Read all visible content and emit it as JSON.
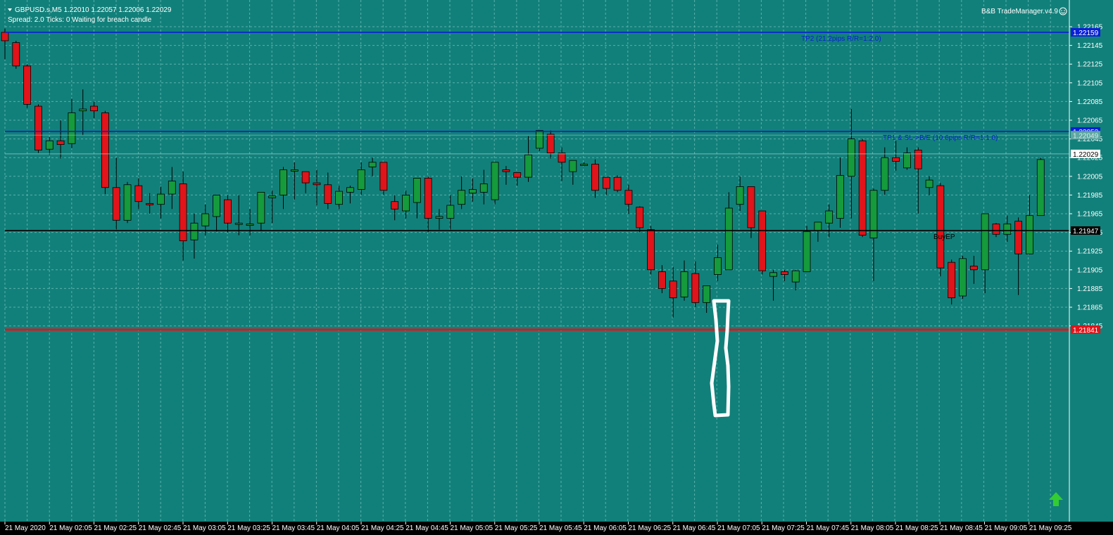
{
  "header": {
    "symbol_line": "GBPUSD.s,M5  1.22010 1.22057 1.22006 1.22029",
    "status_line": "Spread: 2.0  Ticks: 0  Waiting for breach candle",
    "ea_name": "B&B TradeManager.v4.9"
  },
  "colors": {
    "background": "#12807a",
    "grid": "#5bb0a9",
    "bull": "#159a3c",
    "bear": "#e0141a",
    "tp_line": "#0a1fd8",
    "entry_line": "#000000",
    "sl_line": "#e0141a",
    "annotation": "#ffffff",
    "arrow": "#33cc33"
  },
  "lines": {
    "tp2": {
      "price": 1.22159,
      "label": "TP2 (21.2pips R/R=1:2.0)",
      "tag": "1.22159"
    },
    "tp1": {
      "price": 1.22053,
      "label": "TP1 & SL->B/E (10.6pips R/R=1:1.0)",
      "tag": "1.22053"
    },
    "entry": {
      "price": 1.21947,
      "label": "BuyEP",
      "tag": "1.21947"
    },
    "sl": {
      "price": 1.21841,
      "tag": "1.21841"
    },
    "bid": {
      "price": 1.22029,
      "tag": "1.22029"
    },
    "ask": {
      "price": 1.22049,
      "tag": "1.22049"
    }
  },
  "price_axis": {
    "ticks": [
      "1.22165",
      "1.22145",
      "1.22125",
      "1.22105",
      "1.22085",
      "1.22065",
      "1.22045",
      "1.22025",
      "1.22005",
      "1.21985",
      "1.21965",
      "1.21945",
      "1.21925",
      "1.21905",
      "1.21885",
      "1.21865",
      "1.21845"
    ]
  },
  "time_axis": {
    "labels": [
      "21 May 2020",
      "21 May 02:05",
      "21 May 02:25",
      "21 May 02:45",
      "21 May 03:05",
      "21 May 03:25",
      "21 May 03:45",
      "21 May 04:05",
      "21 May 04:25",
      "21 May 04:45",
      "21 May 05:05",
      "21 May 05:25",
      "21 May 05:45",
      "21 May 06:05",
      "21 May 06:25",
      "21 May 06:45",
      "21 May 07:05",
      "21 May 07:25",
      "21 May 07:45",
      "21 May 08:05",
      "21 May 08:25",
      "21 May 08:45",
      "21 May 09:05",
      "21 May 09:25"
    ]
  },
  "icons": {
    "menu": "triangle-down-icon",
    "smiley": "smiley-icon",
    "arrow": "up-arrow-icon"
  },
  "chart_data": {
    "type": "candlestick",
    "symbol": "GBPUSD.s",
    "timeframe": "M5",
    "ylim": [
      1.21834,
      1.2218
    ],
    "candles": [
      {
        "o": 1.22159,
        "h": 1.22163,
        "l": 1.2213,
        "c": 1.2215
      },
      {
        "o": 1.22148,
        "h": 1.2215,
        "l": 1.2212,
        "c": 1.22123
      },
      {
        "o": 1.22123,
        "h": 1.22125,
        "l": 1.22078,
        "c": 1.22082
      },
      {
        "o": 1.2208,
        "h": 1.22082,
        "l": 1.2203,
        "c": 1.22033
      },
      {
        "o": 1.22034,
        "h": 1.22047,
        "l": 1.22028,
        "c": 1.22043
      },
      {
        "o": 1.22043,
        "h": 1.22065,
        "l": 1.22024,
        "c": 1.22039
      },
      {
        "o": 1.2204,
        "h": 1.22088,
        "l": 1.22035,
        "c": 1.22073
      },
      {
        "o": 1.22075,
        "h": 1.22098,
        "l": 1.22049,
        "c": 1.22077
      },
      {
        "o": 1.2208,
        "h": 1.22085,
        "l": 1.22067,
        "c": 1.22075
      },
      {
        "o": 1.22073,
        "h": 1.22075,
        "l": 1.21986,
        "c": 1.21993
      },
      {
        "o": 1.21993,
        "h": 1.22025,
        "l": 1.21948,
        "c": 1.21958
      },
      {
        "o": 1.21958,
        "h": 1.21999,
        "l": 1.21955,
        "c": 1.21996
      },
      {
        "o": 1.21995,
        "h": 1.22003,
        "l": 1.2197,
        "c": 1.21978
      },
      {
        "o": 1.21976,
        "h": 1.21987,
        "l": 1.21965,
        "c": 1.21975
      },
      {
        "o": 1.21975,
        "h": 1.21994,
        "l": 1.2196,
        "c": 1.21986
      },
      {
        "o": 1.21986,
        "h": 1.22015,
        "l": 1.2197,
        "c": 1.22
      },
      {
        "o": 1.21997,
        "h": 1.2201,
        "l": 1.21915,
        "c": 1.21936
      },
      {
        "o": 1.21937,
        "h": 1.21965,
        "l": 1.21917,
        "c": 1.21955
      },
      {
        "o": 1.21952,
        "h": 1.21975,
        "l": 1.21942,
        "c": 1.21965
      },
      {
        "o": 1.21962,
        "h": 1.2198,
        "l": 1.21946,
        "c": 1.21985
      },
      {
        "o": 1.2198,
        "h": 1.21985,
        "l": 1.21945,
        "c": 1.21955
      },
      {
        "o": 1.21954,
        "h": 1.21985,
        "l": 1.21942,
        "c": 1.21955
      },
      {
        "o": 1.21954,
        "h": 1.2197,
        "l": 1.21942,
        "c": 1.21954
      },
      {
        "o": 1.21955,
        "h": 1.2198,
        "l": 1.21947,
        "c": 1.21988
      },
      {
        "o": 1.21982,
        "h": 1.2199,
        "l": 1.21955,
        "c": 1.21984
      },
      {
        "o": 1.21985,
        "h": 1.22015,
        "l": 1.2197,
        "c": 1.22012
      },
      {
        "o": 1.22012,
        "h": 1.2202,
        "l": 1.2198,
        "c": 1.22012
      },
      {
        "o": 1.2201,
        "h": 1.22008,
        "l": 1.21987,
        "c": 1.21998
      },
      {
        "o": 1.21998,
        "h": 1.22012,
        "l": 1.21974,
        "c": 1.21996
      },
      {
        "o": 1.21996,
        "h": 1.22009,
        "l": 1.2197,
        "c": 1.21976
      },
      {
        "o": 1.21975,
        "h": 1.21995,
        "l": 1.2197,
        "c": 1.21989
      },
      {
        "o": 1.21988,
        "h": 1.21995,
        "l": 1.21976,
        "c": 1.21993
      },
      {
        "o": 1.21991,
        "h": 1.2202,
        "l": 1.21985,
        "c": 1.22012
      },
      {
        "o": 1.22015,
        "h": 1.22025,
        "l": 1.22005,
        "c": 1.2202
      },
      {
        "o": 1.2202,
        "h": 1.22018,
        "l": 1.21985,
        "c": 1.2199
      },
      {
        "o": 1.21978,
        "h": 1.21985,
        "l": 1.21958,
        "c": 1.2197
      },
      {
        "o": 1.21968,
        "h": 1.2199,
        "l": 1.2196,
        "c": 1.21985
      },
      {
        "o": 1.21977,
        "h": 1.22,
        "l": 1.2196,
        "c": 1.22003
      },
      {
        "o": 1.22003,
        "h": 1.22005,
        "l": 1.21945,
        "c": 1.2196
      },
      {
        "o": 1.2196,
        "h": 1.2197,
        "l": 1.21948,
        "c": 1.21962
      },
      {
        "o": 1.2196,
        "h": 1.21985,
        "l": 1.21948,
        "c": 1.21974
      },
      {
        "o": 1.21975,
        "h": 1.22005,
        "l": 1.2197,
        "c": 1.2199
      },
      {
        "o": 1.21987,
        "h": 1.22003,
        "l": 1.21978,
        "c": 1.21991
      },
      {
        "o": 1.21988,
        "h": 1.22012,
        "l": 1.21975,
        "c": 1.21997
      },
      {
        "o": 1.2198,
        "h": 1.2202,
        "l": 1.21975,
        "c": 1.2202
      },
      {
        "o": 1.22012,
        "h": 1.22016,
        "l": 1.21996,
        "c": 1.2201
      },
      {
        "o": 1.22009,
        "h": 1.22005,
        "l": 1.21995,
        "c": 1.22004
      },
      {
        "o": 1.22004,
        "h": 1.22048,
        "l": 1.21999,
        "c": 1.22028
      },
      {
        "o": 1.22035,
        "h": 1.22054,
        "l": 1.22032,
        "c": 1.22054
      },
      {
        "o": 1.2205,
        "h": 1.22054,
        "l": 1.22024,
        "c": 1.2203
      },
      {
        "o": 1.2203,
        "h": 1.22036,
        "l": 1.22,
        "c": 1.2202
      },
      {
        "o": 1.2201,
        "h": 1.2202,
        "l": 1.21996,
        "c": 1.22022
      },
      {
        "o": 1.22018,
        "h": 1.2202,
        "l": 1.22016,
        "c": 1.22018
      },
      {
        "o": 1.22018,
        "h": 1.22023,
        "l": 1.21982,
        "c": 1.2199
      },
      {
        "o": 1.22004,
        "h": 1.22003,
        "l": 1.21985,
        "c": 1.21992
      },
      {
        "o": 1.22004,
        "h": 1.22006,
        "l": 1.21988,
        "c": 1.2199
      },
      {
        "o": 1.2199,
        "h": 1.21996,
        "l": 1.21965,
        "c": 1.21975
      },
      {
        "o": 1.21972,
        "h": 1.21973,
        "l": 1.21945,
        "c": 1.2195
      },
      {
        "o": 1.21948,
        "h": 1.21952,
        "l": 1.219,
        "c": 1.21905
      },
      {
        "o": 1.21903,
        "h": 1.2191,
        "l": 1.2188,
        "c": 1.21885
      },
      {
        "o": 1.21893,
        "h": 1.21908,
        "l": 1.21854,
        "c": 1.21875
      },
      {
        "o": 1.21876,
        "h": 1.21915,
        "l": 1.21872,
        "c": 1.21903
      },
      {
        "o": 1.21901,
        "h": 1.21914,
        "l": 1.21865,
        "c": 1.2187
      },
      {
        "o": 1.2187,
        "h": 1.21888,
        "l": 1.21859,
        "c": 1.21888
      },
      {
        "o": 1.219,
        "h": 1.21932,
        "l": 1.21893,
        "c": 1.21918
      },
      {
        "o": 1.21905,
        "h": 1.21988,
        "l": 1.21905,
        "c": 1.21971
      },
      {
        "o": 1.21975,
        "h": 1.22005,
        "l": 1.21968,
        "c": 1.21994
      },
      {
        "o": 1.21994,
        "h": 1.21994,
        "l": 1.21939,
        "c": 1.2195
      },
      {
        "o": 1.21968,
        "h": 1.21968,
        "l": 1.219,
        "c": 1.21904
      },
      {
        "o": 1.21898,
        "h": 1.21905,
        "l": 1.21872,
        "c": 1.21902
      },
      {
        "o": 1.21903,
        "h": 1.21905,
        "l": 1.21893,
        "c": 1.219
      },
      {
        "o": 1.21892,
        "h": 1.21905,
        "l": 1.21883,
        "c": 1.21904
      },
      {
        "o": 1.21903,
        "h": 1.21952,
        "l": 1.21903,
        "c": 1.21946
      },
      {
        "o": 1.21947,
        "h": 1.21955,
        "l": 1.21935,
        "c": 1.21956
      },
      {
        "o": 1.21955,
        "h": 1.21975,
        "l": 1.2194,
        "c": 1.21968
      },
      {
        "o": 1.2196,
        "h": 1.22025,
        "l": 1.2195,
        "c": 1.22006
      },
      {
        "o": 1.22005,
        "h": 1.22077,
        "l": 1.2196,
        "c": 1.22045
      },
      {
        "o": 1.22043,
        "h": 1.22045,
        "l": 1.2194,
        "c": 1.21942
      },
      {
        "o": 1.21939,
        "h": 1.21992,
        "l": 1.21893,
        "c": 1.2199
      },
      {
        "o": 1.2199,
        "h": 1.22036,
        "l": 1.21985,
        "c": 1.22025
      },
      {
        "o": 1.22025,
        "h": 1.22043,
        "l": 1.22011,
        "c": 1.22021
      },
      {
        "o": 1.22014,
        "h": 1.22036,
        "l": 1.22012,
        "c": 1.2203
      },
      {
        "o": 1.22033,
        "h": 1.22036,
        "l": 1.21965,
        "c": 1.22013
      },
      {
        "o": 1.21993,
        "h": 1.22005,
        "l": 1.21985,
        "c": 1.22001
      },
      {
        "o": 1.21995,
        "h": 1.21998,
        "l": 1.21898,
        "c": 1.21907
      },
      {
        "o": 1.21913,
        "h": 1.21916,
        "l": 1.21868,
        "c": 1.21875
      },
      {
        "o": 1.21877,
        "h": 1.2192,
        "l": 1.21874,
        "c": 1.21917
      },
      {
        "o": 1.21909,
        "h": 1.2192,
        "l": 1.2189,
        "c": 1.21905
      },
      {
        "o": 1.21905,
        "h": 1.21965,
        "l": 1.2188,
        "c": 1.21965
      },
      {
        "o": 1.21954,
        "h": 1.21955,
        "l": 1.2194,
        "c": 1.21943
      },
      {
        "o": 1.21943,
        "h": 1.21963,
        "l": 1.21935,
        "c": 1.21954
      },
      {
        "o": 1.21957,
        "h": 1.21961,
        "l": 1.21878,
        "c": 1.21922
      },
      {
        "o": 1.21922,
        "h": 1.21985,
        "l": 1.21922,
        "c": 1.21963
      },
      {
        "o": 1.21963,
        "h": 1.22025,
        "l": 1.21963,
        "c": 1.22023
      }
    ]
  }
}
